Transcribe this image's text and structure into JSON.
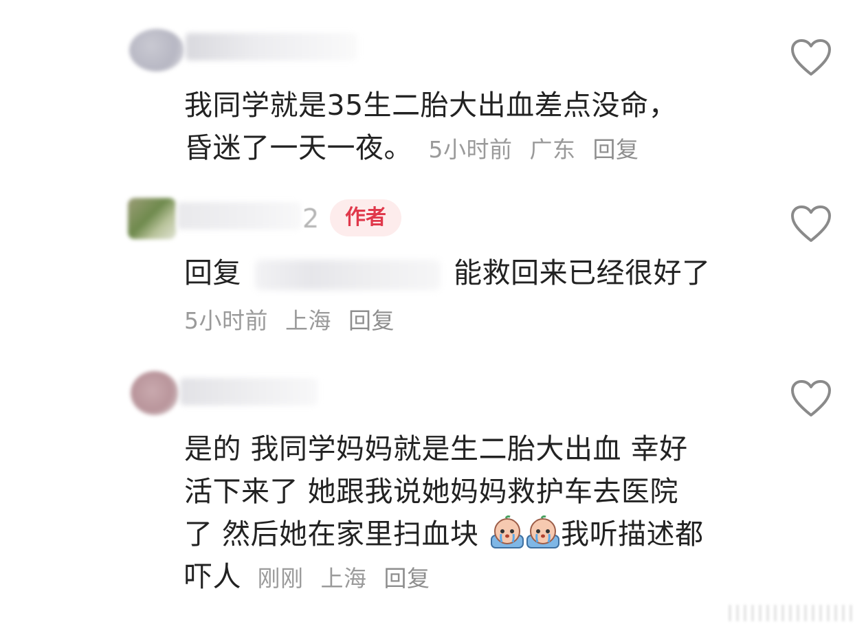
{
  "comments": [
    {
      "text_line1": "我同学就是35生二胎大出血差点没命，",
      "text_line2": "昏迷了一天一夜。",
      "time": "5小时前",
      "location": "广东",
      "reply_label": "回复"
    },
    {
      "author_badge": "作者",
      "name_fragment": "2",
      "reply_prefix": "回复",
      "text": "能救回来已经很好了",
      "time": "5小时前",
      "location": "上海",
      "reply_label": "回复"
    },
    {
      "text_line1": "是的 我同学妈妈就是生二胎大出血 幸好",
      "text_line2": "活下来了 她跟我说她妈妈救护车去医院",
      "text_line3a": "了 然后她在家里扫血块",
      "text_line3b": "我听描述都",
      "text_line4": "吓人",
      "time": "刚刚",
      "location": "上海",
      "reply_label": "回复"
    }
  ],
  "icons": {
    "like": "heart-outline-icon",
    "emoji": "crying-face-emoji-icon"
  },
  "colors": {
    "text": "#222222",
    "meta": "#9a9a9a",
    "badge_bg": "#fdecec",
    "badge_text": "#e0384b",
    "heart_stroke": "#8a8a8a"
  }
}
